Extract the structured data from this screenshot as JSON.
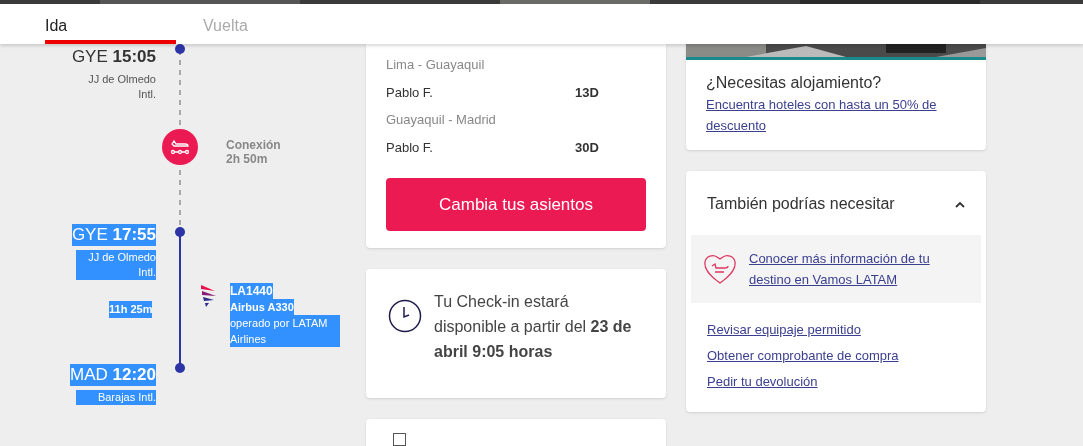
{
  "tabs": [
    {
      "label": "Ida",
      "selected": true
    },
    {
      "label": "Vuelta",
      "selected": false
    }
  ],
  "itinerary": {
    "stops": [
      {
        "code": "GYE",
        "time": "15:05",
        "airport": "JJ de Olmedo Intl.",
        "highlighted": false
      },
      {
        "code": "GYE",
        "time": "17:55",
        "airport": "JJ de Olmedo Intl.",
        "highlighted": true
      },
      {
        "code": "MAD",
        "time": "12:20",
        "airport": "Barajas Intl.",
        "highlighted": true
      }
    ],
    "connection": {
      "label": "Conexión",
      "duration": "2h 50m"
    },
    "flight": {
      "duration": "11h 25m",
      "number": "LA1440",
      "aircraft": "Airbus A330",
      "operator": "operado por LATAM Airlines",
      "highlighted": true
    }
  },
  "seats": {
    "legs": [
      {
        "route": "Lima - Guayaquil",
        "passenger": "Pablo F.",
        "seat": "13D"
      },
      {
        "route": "Guayaquil - Madrid",
        "passenger": "Pablo F.",
        "seat": "30D"
      }
    ],
    "button": "Cambia tus asientos"
  },
  "checkin": {
    "text": "Tu Check-in estará disponible a partir del **23 de abril 9:05 horas**"
  },
  "next_card": {
    "checkbox": {
      "checked": false
    }
  },
  "hotel": {
    "kind": "picture",
    "title": "¿Necesitas alojamiento?",
    "link": "Encuentra hoteles con hasta un 50% de descuento"
  },
  "extras": {
    "title": "También podrías necesitar",
    "expanded": true,
    "featured_link": "Conocer más información de tu destino en Vamos LATAM",
    "links": [
      "Revisar equipaje permitido",
      "Obtener comprobante de compra",
      "Pedir tu devolución"
    ]
  }
}
